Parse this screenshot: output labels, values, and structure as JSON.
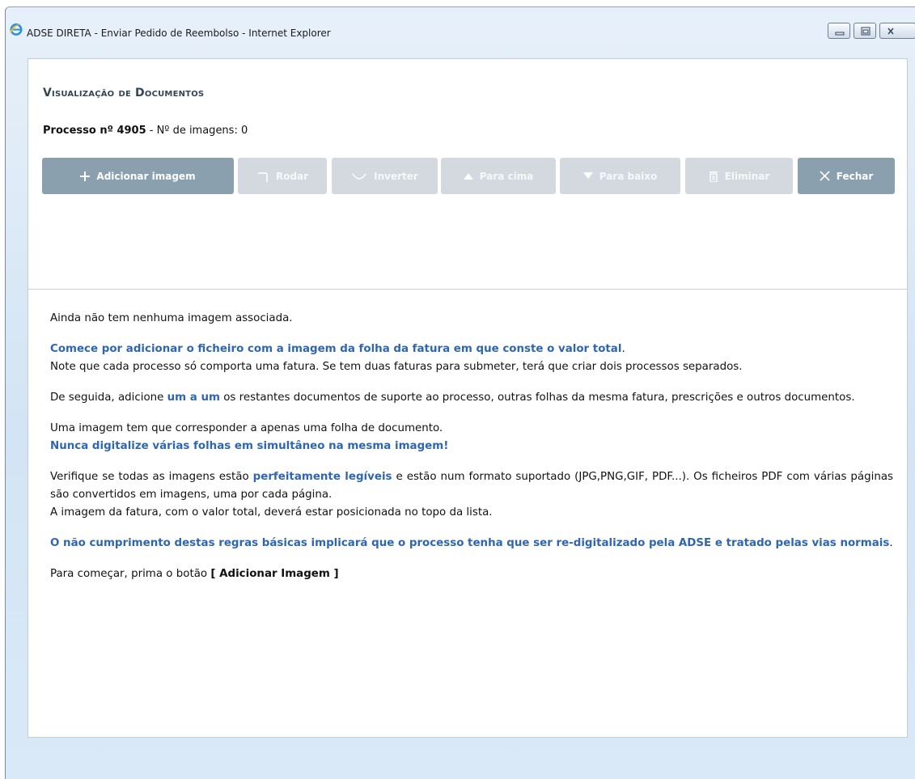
{
  "window": {
    "title": "ADSE DIRETA - Enviar Pedido de Reembolso - Internet Explorer",
    "controls": [
      "minimize-icon",
      "restore-icon",
      "close-icon"
    ]
  },
  "page": {
    "heading": "Visualização de Documentos",
    "process_label": "Processo nº 4905",
    "images_label": " - Nº de imagens: 0"
  },
  "toolbar": [
    {
      "label": "Adicionar imagem",
      "icon": "plus-icon",
      "enabled": true
    },
    {
      "label": "Rodar",
      "icon": "rotate-icon",
      "enabled": false
    },
    {
      "label": "Inverter",
      "icon": "flip-icon",
      "enabled": false
    },
    {
      "label": "Para cima",
      "icon": "arrow-up-icon",
      "enabled": false
    },
    {
      "label": "Para baixo",
      "icon": "arrow-down-icon",
      "enabled": false
    },
    {
      "label": "Eliminar",
      "icon": "trash-icon",
      "enabled": false
    },
    {
      "label": "Fechar",
      "icon": "close-icon",
      "enabled": true
    }
  ],
  "instructions": {
    "p1": "Ainda não tem nenhuma imagem associada.",
    "p2_highlight": "Comece por adicionar o ficheiro com a imagem da folha da fatura em que conste o valor total",
    "p2_dot": ".",
    "p2_rest": "Note que cada processo só comporta uma fatura. Se tem duas faturas para submeter, terá que criar dois processos separados.",
    "p3_before": "De seguida, adicione ",
    "p3_highlight": "um a um",
    "p3_after": " os restantes documentos de suporte ao processo, outras folhas da mesma fatura, prescrições e outros documentos.",
    "p4_line1": "Uma imagem tem que corresponder a apenas uma folha de documento.",
    "p4_highlight": "Nunca digitalize várias folhas em simultâneo na mesma imagem!",
    "p5_before": "Verifique se todas as imagens estão ",
    "p5_highlight": "perfeitamente legíveis",
    "p5_after": " e estão num formato suportado (JPG,PNG,GIF, PDF...). Os ficheiros PDF com várias páginas são convertidos em imagens, uma por cada página.",
    "p5_line3": "A imagem da fatura, com o valor total, deverá estar posicionada no topo da lista.",
    "p6_highlight": "O não cumprimento destas regras básicas implicará que o processo tenha que ser re-digitalizado pela ADSE e tratado pelas vias normais",
    "p6_dot": ".",
    "p7_before": "Para começar, prima o botão ",
    "p7_bold": "[ Adicionar Imagem ]"
  },
  "colors": {
    "button_enabled": "#8aa0ae",
    "button_disabled": "#d3d9de",
    "highlight_blue": "#2f66b3",
    "heading": "#344556"
  }
}
